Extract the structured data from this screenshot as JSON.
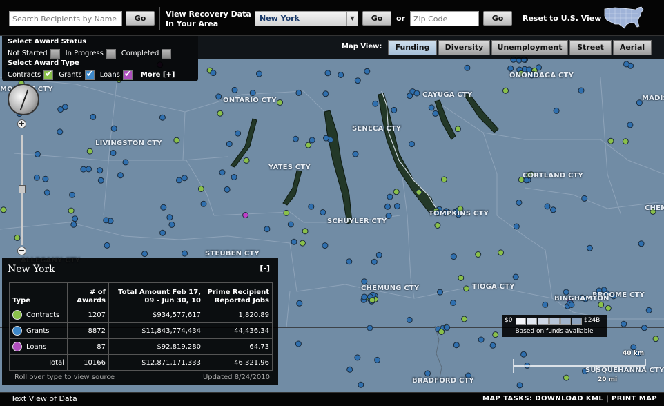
{
  "header": {
    "search_placeholder": "Search Recipients by Name",
    "go_label": "Go",
    "recovery_line1": "View Recovery Data",
    "recovery_line2": "In Your Area",
    "state_selected": "New York",
    "or_label": "or",
    "zip_placeholder": "Zip Code",
    "reset_label": "Reset to U.S. View"
  },
  "status_panel": {
    "status_title": "Select Award Status",
    "statuses": [
      {
        "label": "Not Started",
        "checked": false
      },
      {
        "label": "In Progress",
        "checked": false
      },
      {
        "label": "Completed",
        "checked": false
      }
    ],
    "type_title": "Select Award Type",
    "types": [
      {
        "label": "Contracts",
        "checked": true
      },
      {
        "label": "Grants",
        "checked": true
      },
      {
        "label": "Loans",
        "checked": true
      }
    ],
    "more_label": "More [+]"
  },
  "map_view": {
    "label": "Map View:",
    "tabs": [
      "Funding",
      "Diversity",
      "Unemployment",
      "Street",
      "Aerial"
    ],
    "active": "Funding"
  },
  "map_labels": [
    "ONONDAGA CTY",
    "CAYUGA CTY",
    "ONTARIO CTY",
    "SENECA CTY",
    "LIVINGSTON CTY",
    "YATES CTY",
    "CORTLAND CTY",
    "SCHUYLER CTY",
    "TOMPKINS CTY",
    "STEUBEN CTY",
    "CHEMUNG CTY",
    "TIOGA CTY",
    "BROOME CTY",
    "BRADFORD CTY",
    "SUSQUEHANNA CTY",
    "MONROE CTY",
    "MADISON",
    "CHENANGO",
    "BINGHAMTON",
    "ALLEGANY CTY"
  ],
  "data_panel": {
    "title": "New York",
    "collapse_label": "[-]",
    "headers": [
      "Type",
      "# of Awards",
      "Total Amount Feb 17, 09 - Jun 30, 10",
      "Prime Recipient Reported Jobs"
    ],
    "rows": [
      {
        "type": "Contracts",
        "awards": "1207",
        "amount": "$934,577,617",
        "jobs": "1,820.89",
        "color": "#8ac04a"
      },
      {
        "type": "Grants",
        "awards": "8872",
        "amount": "$11,843,774,434",
        "jobs": "44,436.34",
        "color": "#3d88c9"
      },
      {
        "type": "Loans",
        "awards": "87",
        "amount": "$92,819,280",
        "jobs": "64.73",
        "color": "#b04fbf"
      }
    ],
    "total": {
      "label": "Total",
      "awards": "10166",
      "amount": "$12,871,171,333",
      "jobs": "46,321.96"
    },
    "footer_left": "Roll over type to view source",
    "footer_right": "Updated 8/24/2010"
  },
  "legend": {
    "min_label": "$0",
    "max_label": "$24B",
    "subtitle": "Based on funds available",
    "ramp_colors": [
      "#f2f4f8",
      "#e0e6ef",
      "#cdd6e4",
      "#b6c4d7",
      "#9fb2ca",
      "#8ba1bd"
    ]
  },
  "scale": {
    "km": "40 km",
    "mi": "20 mi"
  },
  "footer": {
    "text_view": "Text View of Data",
    "map_tasks": "MAP TASKS:  DOWNLOAD KML  |  PRINT MAP"
  },
  "colors": {
    "contracts": "#8ac04a",
    "grants": "#2f6fae",
    "loans": "#c03fc8",
    "map_bg": "#718ca5"
  }
}
